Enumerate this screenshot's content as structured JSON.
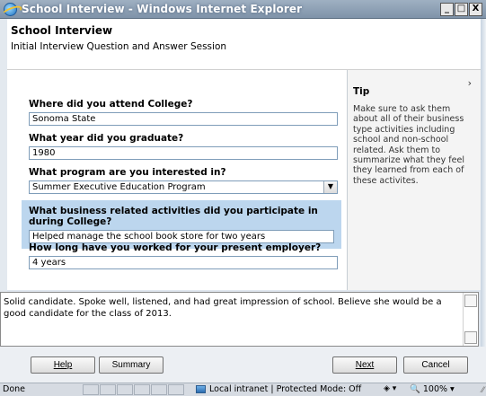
{
  "window": {
    "title": "School Interview - Windows Internet Explorer",
    "minimize": "_",
    "maximize": "□",
    "close": "X"
  },
  "header": {
    "title": "School Interview",
    "subtitle": "Initial Interview Question and Answer Session"
  },
  "questions": [
    {
      "label": "Where did you attend College?",
      "value": "Sonoma State"
    },
    {
      "label": "What year did you graduate?",
      "value": "1980"
    },
    {
      "label": "What program are you interested in?",
      "value": "Summer Executive Education Program"
    },
    {
      "label": "What business related activities did you participate in during College?",
      "value": "Helped manage the school book store for two years"
    },
    {
      "label": "How long have you worked for your present employer?",
      "value": "4 years"
    }
  ],
  "tip": {
    "chevron": "›",
    "title": "Tip",
    "text": "Make sure to ask them about all of their business type activities including school and non-school related. Ask them to summarize what they feel they learned from each of these activites."
  },
  "notes": {
    "text": "Solid candidate. Spoke well, listened, and had great impression of school. Believe she would be a good candidate for the class of 2013."
  },
  "buttons": {
    "help": "Help",
    "summary": "Summary",
    "next": "Next",
    "cancel": "Cancel"
  },
  "status": {
    "left": "Done",
    "zone": "Local intranet | Protected Mode: Off",
    "zoom": "100%"
  }
}
